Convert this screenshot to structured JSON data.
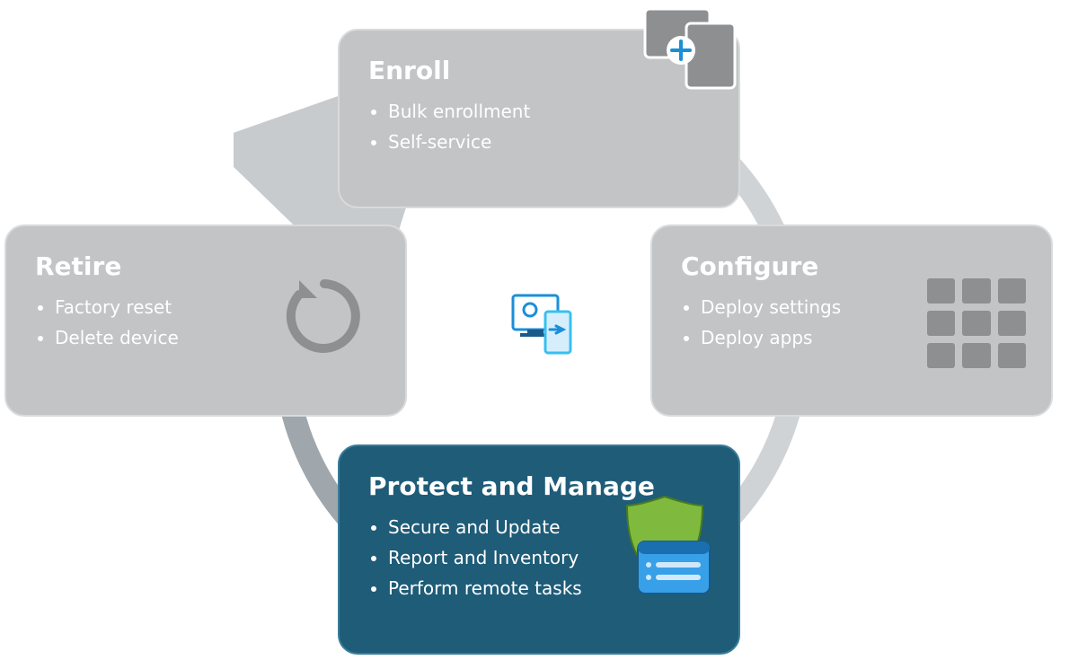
{
  "cycle": {
    "enroll": {
      "title": "Enroll",
      "items": [
        "Bulk enrollment",
        "Self-service"
      ],
      "icon": "devices-plus-icon",
      "active": false
    },
    "configure": {
      "title": "Configure",
      "items": [
        "Deploy settings",
        "Deploy apps"
      ],
      "icon": "apps-grid-icon",
      "active": false
    },
    "protect": {
      "title": "Protect and Manage",
      "items": [
        "Secure and Update",
        "Report and Inventory",
        "Perform remote tasks"
      ],
      "icon": "shield-list-icon",
      "active": true
    },
    "retire": {
      "title": "Retire",
      "items": [
        "Factory reset",
        "Delete device"
      ],
      "icon": "reset-cycle-icon",
      "active": false
    }
  },
  "center_icon": "intune-monitor-icon",
  "colors": {
    "muted_bg": "#c2c4c6",
    "active_bg": "#1e5c78",
    "arc_light": "#d0d3d6",
    "arc_dark": "#9fa7ad",
    "accent_blue": "#1a8fd8",
    "accent_green": "#7fba3e"
  }
}
